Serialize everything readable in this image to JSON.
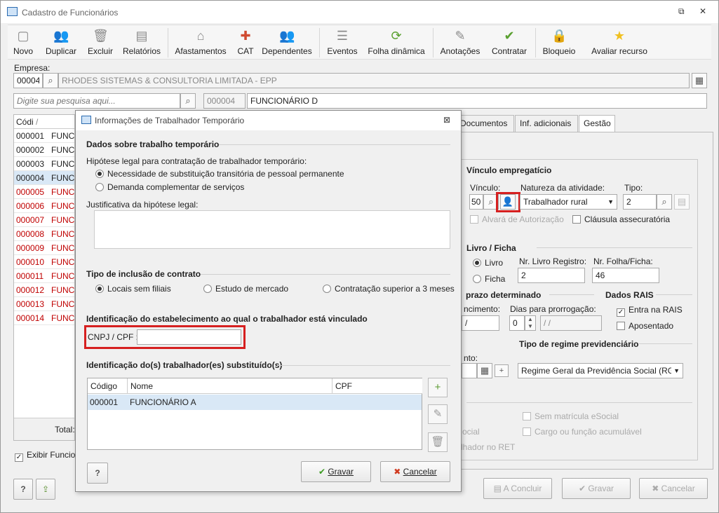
{
  "window": {
    "title": "Cadastro de Funcionários",
    "restore_glyph": "⧉",
    "close_glyph": "✕"
  },
  "toolbar": [
    {
      "label": "Novo",
      "icon": "new-doc-icon",
      "glyph": "▢"
    },
    {
      "label": "Duplicar",
      "icon": "duplicate-users-icon",
      "glyph": "👥"
    },
    {
      "label": "Excluir",
      "icon": "trash-icon",
      "glyph": "🗑"
    },
    {
      "label": "Relatórios",
      "icon": "report-icon",
      "glyph": "▤"
    },
    {
      "label": "Afastamentos",
      "icon": "house-arrow-icon",
      "glyph": "⌂"
    },
    {
      "label": "CAT",
      "icon": "medical-cross-icon",
      "glyph": "✚"
    },
    {
      "label": "Dependentes",
      "icon": "dependents-icon",
      "glyph": "👥"
    },
    {
      "label": "Eventos",
      "icon": "list-icon",
      "glyph": "☰"
    },
    {
      "label": "Folha dinâmica",
      "icon": "refresh-sheet-icon",
      "glyph": "⟳"
    },
    {
      "label": "Anotações",
      "icon": "notes-icon",
      "glyph": "✎"
    },
    {
      "label": "Contratar",
      "icon": "hire-icon",
      "glyph": "✔"
    },
    {
      "label": "Bloqueio",
      "icon": "lock-icon",
      "glyph": "🔒"
    },
    {
      "label": "Avaliar recurso",
      "icon": "star-icon",
      "glyph": "★"
    }
  ],
  "empresa": {
    "label": "Empresa:",
    "code": "00004",
    "name": "RHODES SISTEMAS & CONSULTORIA LIMITADA - EPP"
  },
  "search": {
    "placeholder": "Digite sua pesquisa aqui...",
    "code": "000004",
    "name": "FUNCIONÁRIO D"
  },
  "grid": {
    "header": "Códi",
    "sort_glyph": "/",
    "rows": [
      {
        "code": "000001",
        "name": "FUNCI",
        "red": false,
        "sel": false
      },
      {
        "code": "000002",
        "name": "FUNCI",
        "red": false,
        "sel": false
      },
      {
        "code": "000003",
        "name": "FUNCI",
        "red": false,
        "sel": false
      },
      {
        "code": "000004",
        "name": "FUNCI",
        "red": false,
        "sel": true
      },
      {
        "code": "000005",
        "name": "FUNCI",
        "red": true,
        "sel": false
      },
      {
        "code": "000006",
        "name": "FUNCI",
        "red": true,
        "sel": false
      },
      {
        "code": "000007",
        "name": "FUNCI",
        "red": true,
        "sel": false
      },
      {
        "code": "000008",
        "name": "FUNCI",
        "red": true,
        "sel": false
      },
      {
        "code": "000009",
        "name": "FUNCI",
        "red": true,
        "sel": false
      },
      {
        "code": "000010",
        "name": "FUNCI",
        "red": true,
        "sel": false
      },
      {
        "code": "000011",
        "name": "FUNCI",
        "red": true,
        "sel": false
      },
      {
        "code": "000012",
        "name": "FUNCI",
        "red": true,
        "sel": false
      },
      {
        "code": "000013",
        "name": "FUNCI",
        "red": true,
        "sel": false
      },
      {
        "code": "000014",
        "name": "FUNCI",
        "red": true,
        "sel": false
      }
    ],
    "total_label": "Total:",
    "exibir_label": "Exibir Funcio"
  },
  "tabs": [
    "Documentos",
    "Inf. adicionais",
    "Gestão"
  ],
  "vinculo": {
    "title": "Vínculo empregatício",
    "vinculo_label": "Vínculo:",
    "vinculo_value": "50",
    "natureza_label": "Natureza da atividade:",
    "natureza_value": "Trabalhador rural",
    "tipo_label": "Tipo:",
    "tipo_value": "2",
    "alvara_label": "Alvará de Autorização",
    "clausula_label": "Cláusula assecuratória"
  },
  "livro": {
    "title": "Livro / Ficha",
    "livro_label": "Livro",
    "ficha_label": "Ficha",
    "nr_livro_label": "Nr. Livro Registro:",
    "nr_livro_value": "2",
    "nr_folha_label": "Nr. Folha/Ficha:",
    "nr_folha_value": "46"
  },
  "prazo": {
    "title": "prazo determinado",
    "venc_label": "ncimento:",
    "venc_value": "/",
    "dias_label": "Dias para prorrogação:",
    "dias_value": "0",
    "dias_date": "/ /"
  },
  "rais": {
    "title": "Dados RAIS",
    "entra_label": "Entra na RAIS",
    "aposentado_label": "Aposentado"
  },
  "regime": {
    "title": "Tipo de regime previdenciário",
    "nto_label": "nto:",
    "value": "Regime Geral da Previdência Social (RGP"
  },
  "misc": {
    "sem_matricula": "Sem matrícula eSocial",
    "cargo_acumulavel": "Cargo ou função acumulável",
    "social_frag": "ocial",
    "ret_frag": "lhador no RET"
  },
  "bottom": {
    "help": "?",
    "concluir": "A Concluir",
    "gravar": "Gravar",
    "cancelar": "Cancelar"
  },
  "dialog": {
    "title": "Informações de Trabalhador Temporário",
    "close_glyph": "⊠",
    "sec1": "Dados sobre trabalho temporário",
    "hipotese_label": "Hipótese legal para contratação de trabalhador temporário:",
    "hipotese_opt1": "Necessidade de substituição transitória de pessoal permanente",
    "hipotese_opt2": "Demanda complementar de serviços",
    "justificativa_label": "Justificativa da hipótese legal:",
    "justificativa_value": "",
    "sec2": "Tipo de inclusão de contrato",
    "incl_opt1": "Locais sem filiais",
    "incl_opt2": "Estudo de mercado",
    "incl_opt3": "Contratação superior a 3 meses",
    "sec3": "Identificação do estabelecimento ao qual o trabalhador está vinculado",
    "cnpj_label": "CNPJ / CPF :",
    "cnpj_value": "",
    "sec4": "Identificação do(s) trabalhador(es) substituído(s)",
    "table": {
      "headers": [
        "Código",
        "Nome",
        "CPF"
      ],
      "rows": [
        {
          "codigo": "000001",
          "nome": "FUNCIONÁRIO A",
          "cpf": ""
        }
      ]
    },
    "help": "?",
    "gravar": "Gravar",
    "cancelar": "Cancelar"
  }
}
